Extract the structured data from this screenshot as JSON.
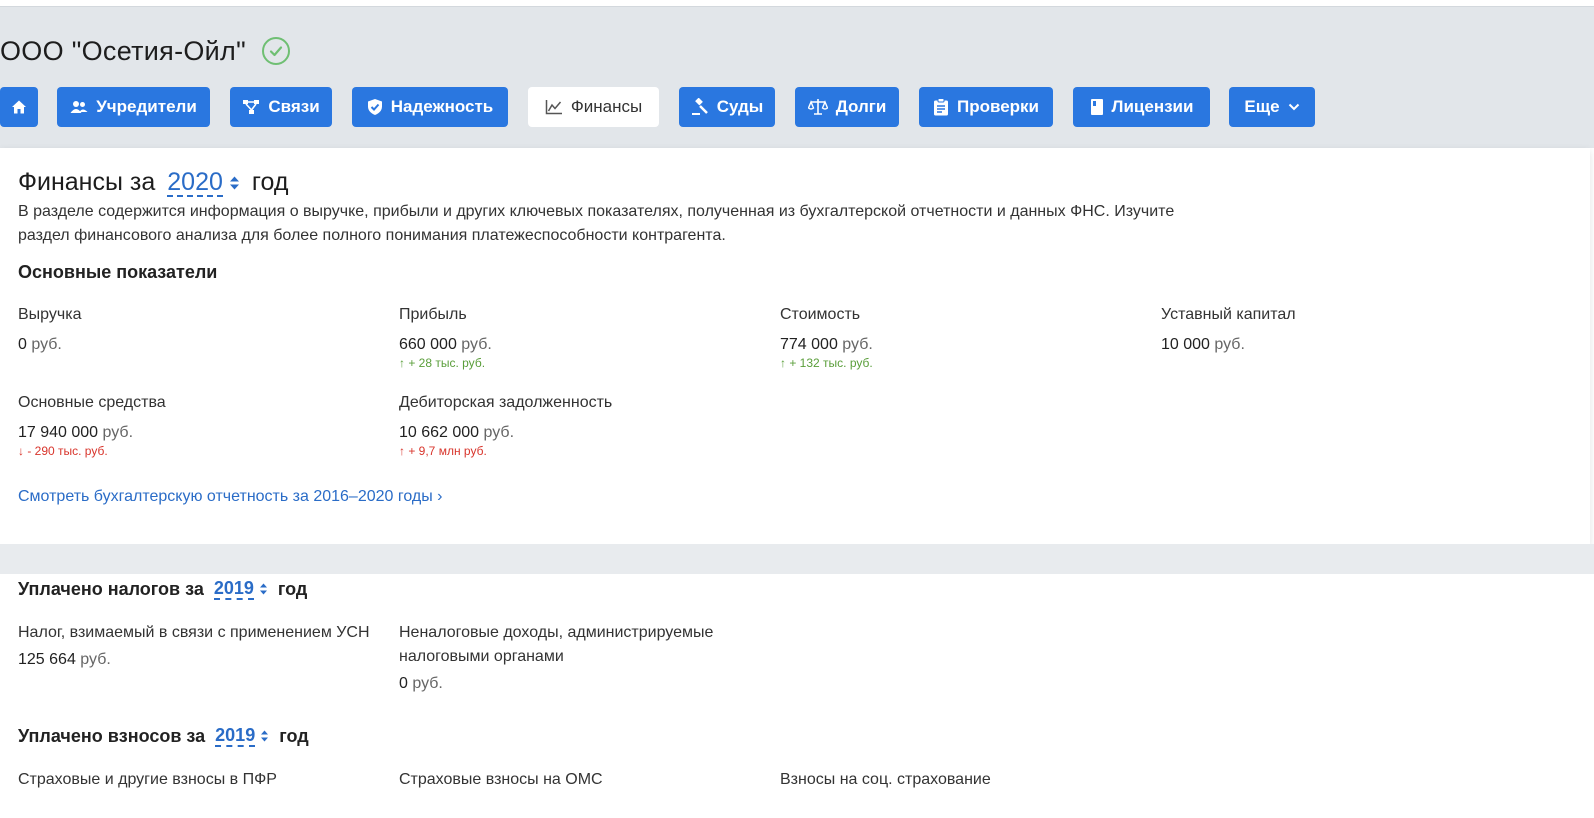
{
  "company": {
    "name": "ООО \"Осетия-Ойл\"",
    "verified_color": "#6fbf73"
  },
  "nav": {
    "accent": "#2a77e0",
    "tabs": [
      {
        "label": "",
        "icon": "home-icon"
      },
      {
        "label": "Учредители",
        "icon": "users-icon"
      },
      {
        "label": "Связи",
        "icon": "connections-icon"
      },
      {
        "label": "Надежность",
        "icon": "shield-icon"
      },
      {
        "label": "Финансы",
        "icon": "chart-icon",
        "active": true
      },
      {
        "label": "Суды",
        "icon": "gavel-icon"
      },
      {
        "label": "Долги",
        "icon": "scales-icon"
      },
      {
        "label": "Проверки",
        "icon": "clipboard-icon"
      },
      {
        "label": "Лицензии",
        "icon": "license-icon"
      },
      {
        "label": "Еще",
        "icon": "chevron-down-icon"
      }
    ]
  },
  "finance": {
    "title_prefix": "Финансы за",
    "year": "2020",
    "title_suffix": "год",
    "description": "В разделе содержится информация о выручке, прибыли и других ключевых показателях, полученная из бухгалтерской отчетности и данных ФНС. Изучите раздел финансового анализа для более полного понимания платежеспособности контрагента.",
    "main_heading": "Основные показатели",
    "unit": "руб.",
    "metrics": [
      {
        "label": "Выручка",
        "value": "0",
        "delta": ""
      },
      {
        "label": "Прибыль",
        "value": "660 000",
        "delta": "↑ + 28 тыс. руб."
      },
      {
        "label": "Стоимость",
        "value": "774 000",
        "delta": "↑ + 132 тыс. руб."
      },
      {
        "label": "Уставный капитал",
        "value": "10 000",
        "delta": ""
      },
      {
        "label": "Основные средства",
        "value": "17 940 000",
        "delta": "↓ - 290 тыс. руб."
      },
      {
        "label": "Дебиторская задолженность",
        "value": "10 662 000",
        "delta": "↑ + 9,7 млн руб."
      }
    ],
    "report_link": "Смотреть бухгалтерскую отчетность за 2016–2020 годы ›"
  },
  "taxes": {
    "title_prefix": "Уплачено налогов за",
    "year": "2019",
    "title_suffix": "год",
    "items": [
      {
        "label": "Налог, взимаемый в связи с применением УСН",
        "value": "125 664"
      },
      {
        "label": "Неналоговые доходы, администрируемые налоговыми органами",
        "value": "0"
      }
    ]
  },
  "contributions": {
    "title_prefix": "Уплачено взносов за",
    "year": "2019",
    "title_suffix": "год",
    "items": [
      {
        "label": "Страховые и другие взносы в ПФР"
      },
      {
        "label": "Страховые взносы на ОМС"
      },
      {
        "label": "Взносы на соц. страхование"
      }
    ]
  }
}
